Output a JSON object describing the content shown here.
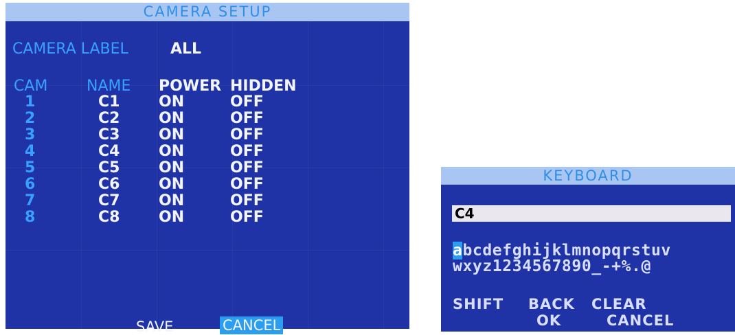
{
  "camera_setup": {
    "title": "CAMERA SETUP",
    "camera_label_text": "CAMERA LABEL",
    "camera_label_value": "ALL",
    "columns": [
      "CAM",
      "NAME",
      "POWER",
      "HIDDEN"
    ],
    "rows": [
      {
        "cam": "1",
        "name": "C1",
        "power": "ON",
        "hidden": "OFF"
      },
      {
        "cam": "2",
        "name": "C2",
        "power": "ON",
        "hidden": "OFF"
      },
      {
        "cam": "3",
        "name": "C3",
        "power": "ON",
        "hidden": "OFF"
      },
      {
        "cam": "4",
        "name": "C4",
        "power": "ON",
        "hidden": "OFF"
      },
      {
        "cam": "5",
        "name": "C5",
        "power": "ON",
        "hidden": "OFF"
      },
      {
        "cam": "6",
        "name": "C6",
        "power": "ON",
        "hidden": "OFF"
      },
      {
        "cam": "7",
        "name": "C7",
        "power": "ON",
        "hidden": "OFF"
      },
      {
        "cam": "8",
        "name": "C8",
        "power": "ON",
        "hidden": "OFF"
      }
    ],
    "save_label": "SAVE",
    "cancel_label": "CANCEL"
  },
  "keyboard": {
    "title": "KEYBOARD",
    "input_value": "C4",
    "row1_selected": "a",
    "row1_rest": "bcdefghijklmnopqrstuv",
    "row2": "wxyz1234567890_-+%.@",
    "shift_label": "SHIFT",
    "back_label": "BACK",
    "clear_label": "CLEAR",
    "ok_label": "OK",
    "cancel_label": "CANCEL"
  },
  "colors": {
    "panel_bg": "#1f33a6",
    "titlebar_bg": "#a9c6f2",
    "title_text": "#2f8fe8",
    "label_blue": "#3aa0ff",
    "highlight": "#2c9ef0"
  }
}
